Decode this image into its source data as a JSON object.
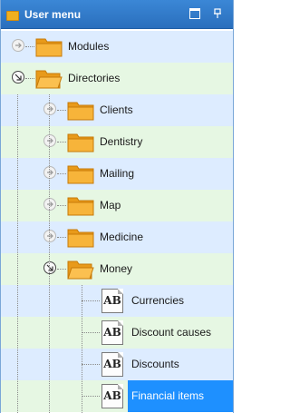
{
  "panel": {
    "title": "User menu"
  },
  "tree": {
    "modules": "Modules",
    "directories": "Directories",
    "clients": "Clients",
    "dentistry": "Dentistry",
    "mailing": "Mailing",
    "map": "Map",
    "medicine": "Medicine",
    "money": "Money",
    "currencies": "Currencies",
    "discount_causes": "Discount causes",
    "discounts": "Discounts",
    "financial_items": "Financial items",
    "leaf_icon_text": "AB"
  },
  "icons": {
    "folder_color": "#f0a020",
    "selection_color": "#1e90ff",
    "header_color": "#2a6fbd"
  }
}
